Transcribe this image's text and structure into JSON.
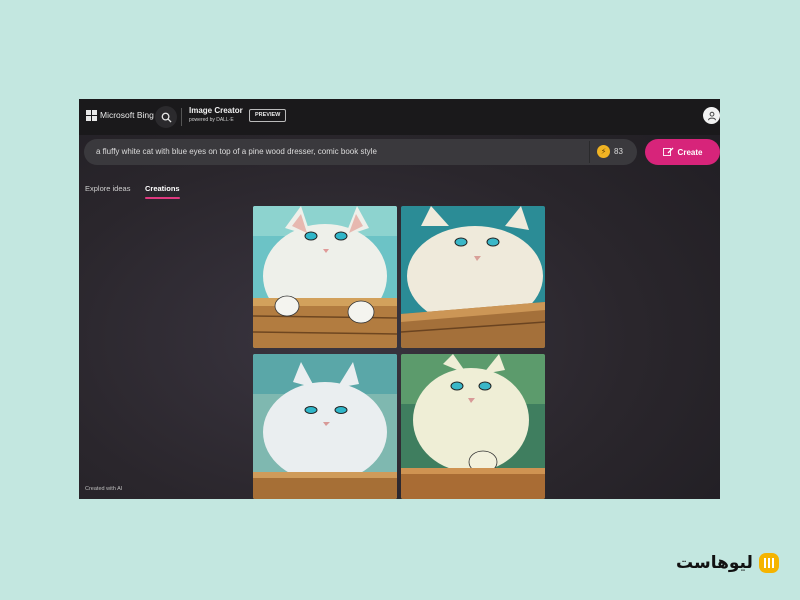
{
  "header": {
    "brand": "Microsoft Bing",
    "app_title": "Image Creator",
    "app_subtitle": "powered by DALL·E",
    "preview_badge": "PREVIEW"
  },
  "prompt": {
    "value": "a fluffy white cat with blue eyes on top of a pine wood dresser, comic book style",
    "boosts_count": "83",
    "create_label": "Create"
  },
  "tabs": [
    {
      "label": "Explore ideas",
      "active": false
    },
    {
      "label": "Creations",
      "active": true
    }
  ],
  "images": [
    {
      "subject": "white cat paws over wooden ledge",
      "background": "teal"
    },
    {
      "subject": "white cat lying on pine dresser",
      "background": "teal"
    },
    {
      "subject": "grumpy white cat on wooden dresser",
      "background": "teal"
    },
    {
      "subject": "white cat peeking over dresser",
      "background": "green"
    }
  ],
  "footer_note": "Created with AI",
  "watermark_text": "لیوهاست",
  "colors": {
    "page_bg": "#c3e7e0",
    "create_button": "#d7247a",
    "tab_underline": "#e0397f",
    "boost_icon": "#f0b323",
    "watermark_logo": "#f5b400"
  }
}
